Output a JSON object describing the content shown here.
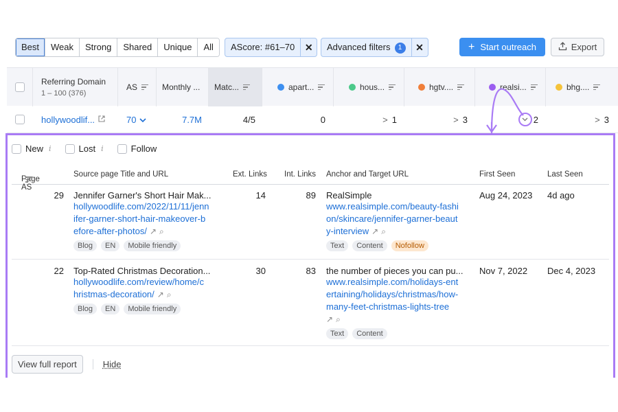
{
  "toolbar": {
    "segments": [
      "Best",
      "Weak",
      "Strong",
      "Shared",
      "Unique",
      "All"
    ],
    "ascore_chip": "AScore: #61–70",
    "advanced_chip": "Advanced filters",
    "advanced_count": "1",
    "close_glyph": "✕",
    "start_outreach": "Start outreach",
    "export": "Export"
  },
  "header": {
    "referring_domain": "Referring Domain",
    "range": "1 – 100 (376)",
    "as": "AS",
    "monthly": "Monthly ...",
    "match": "Matc...",
    "competitors": [
      {
        "name": "apart...",
        "color": "#3d8ff0"
      },
      {
        "name": "hous...",
        "color": "#4cc98a"
      },
      {
        "name": "hgtv....",
        "color": "#f07f3a"
      },
      {
        "name": "realsi...",
        "color": "#9b5ef0"
      },
      {
        "name": "bhg....",
        "color": "#f5c33b"
      }
    ]
  },
  "row": {
    "domain": "hollywoodlif...",
    "as": "70",
    "monthly": "7.7M",
    "match": "4/5",
    "c1": "0",
    "c2": "1",
    "c3": "3",
    "c4": "2",
    "c5": "3"
  },
  "expanded": {
    "filters": [
      "New",
      "Lost",
      "Follow"
    ],
    "columns": {
      "page_as": "Page AS",
      "source": "Source page Title and URL",
      "ext": "Ext. Links",
      "int": "Int. Links",
      "anchor": "Anchor and Target URL",
      "first_seen": "First Seen",
      "last_seen": "Last Seen"
    },
    "rows": [
      {
        "page_as": "29",
        "title": "Jennifer Garner's Short Hair Mak...",
        "url": "hollywoodlife.com/2022/11/11/jennifer-garner-short-hair-makeover-before-after-photos/",
        "url_lines": [
          "hollywoodlife.com/2022/11/11/jenn",
          "ifer-garner-short-hair-makeover-b",
          "efore-after-photos/"
        ],
        "tags": [
          "Blog",
          "EN",
          "Mobile friendly"
        ],
        "ext": "14",
        "int": "89",
        "anchor": "RealSimple",
        "target_lines": [
          "www.realsimple.com/beauty-fashi",
          "on/skincare/jennifer-garner-beaut",
          "y-interview"
        ],
        "anchor_tags": [
          "Text",
          "Content"
        ],
        "anchor_warn_tag": "Nofollow",
        "first_seen": "Aug 24, 2023",
        "last_seen": "4d ago"
      },
      {
        "page_as": "22",
        "title": "Top-Rated Christmas Decoration...",
        "url_lines": [
          "hollywoodlife.com/review/home/c",
          "hristmas-decoration/"
        ],
        "tags": [
          "Blog",
          "EN",
          "Mobile friendly"
        ],
        "ext": "30",
        "int": "83",
        "anchor": "the number of pieces you can pu...",
        "target_lines": [
          "www.realsimple.com/holidays-ent",
          "ertaining/holidays/christmas/how-",
          "many-feet-christmas-lights-tree"
        ],
        "anchor_tags": [
          "Text",
          "Content"
        ],
        "first_seen": "Nov 7, 2022",
        "last_seen": "Dec 4, 2023"
      }
    ],
    "view_full_report": "View full report",
    "hide": "Hide"
  },
  "colors": {
    "accent": "#3b8ff0",
    "highlight": "#a97bf5",
    "link": "#1d6fd6"
  }
}
